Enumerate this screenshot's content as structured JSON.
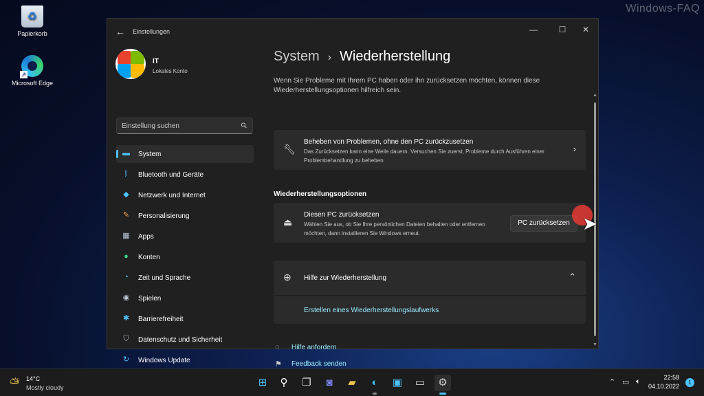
{
  "watermark": "Windows-FAQ",
  "desktop": {
    "icons": [
      {
        "label": "Papierkorb",
        "icon": "recycle-bin-icon"
      },
      {
        "label": "Microsoft Edge",
        "icon": "edge-icon"
      }
    ]
  },
  "window": {
    "title": "Einstellungen",
    "controls": {
      "minimize": "—",
      "maximize": "☐",
      "close": "✕"
    }
  },
  "profile": {
    "name": "IT",
    "account_type": "Lokales Konto"
  },
  "search": {
    "placeholder": "Einstellung suchen"
  },
  "nav": [
    {
      "label": "System",
      "icon": "monitor-icon",
      "active": true
    },
    {
      "label": "Bluetooth und Geräte",
      "icon": "bluetooth-icon"
    },
    {
      "label": "Netzwerk und Internet",
      "icon": "wifi-icon"
    },
    {
      "label": "Personalisierung",
      "icon": "brush-icon"
    },
    {
      "label": "Apps",
      "icon": "apps-icon"
    },
    {
      "label": "Konten",
      "icon": "person-icon"
    },
    {
      "label": "Zeit und Sprache",
      "icon": "globe-clock-icon"
    },
    {
      "label": "Spielen",
      "icon": "gamepad-icon"
    },
    {
      "label": "Barrierefreiheit",
      "icon": "accessibility-icon"
    },
    {
      "label": "Datenschutz und Sicherheit",
      "icon": "shield-icon"
    },
    {
      "label": "Windows Update",
      "icon": "update-icon"
    }
  ],
  "page": {
    "breadcrumb_parent": "System",
    "breadcrumb_sep": "›",
    "breadcrumb_current": "Wiederherstellung",
    "intro": "Wenn Sie Probleme mit Ihrem PC haben oder ihn zurücksetzen möchten, können diese Wiederherstellungsoptionen hilfreich sein.",
    "troubleshoot": {
      "title": "Beheben von Problemen, ohne den PC zurückzusetzen",
      "description": "Das Zurücksetzen kann eine Weile dauern. Versuchen Sie zuerst, Probleme durch Ausführen einer Problembehandlung zu beheben",
      "icon": "wrench-icon"
    },
    "section_header": "Wiederherstellungsoptionen",
    "reset": {
      "title": "Diesen PC zurücksetzen",
      "description": "Wählen Sie aus, ob Sie Ihre persönlichen Dateien behalten oder entfernen möchten, dann installieren Sie Windows erneut.",
      "button": "PC zurücksetzen",
      "icon": "reset-pc-icon"
    },
    "help": {
      "title": "Hilfe zur Wiederherstellung",
      "link": "Erstellen eines Wiederherstellungslaufwerks",
      "icon": "globe-icon"
    },
    "footer_links": [
      {
        "label": "Hilfe anfordern",
        "icon": "help-chat-icon"
      },
      {
        "label": "Feedback senden",
        "icon": "feedback-icon"
      }
    ]
  },
  "taskbar": {
    "weather_temp": "14°C",
    "weather_desc": "Mostly cloudy",
    "time": "22:58",
    "date": "04.10.2022",
    "notifications": "1"
  }
}
